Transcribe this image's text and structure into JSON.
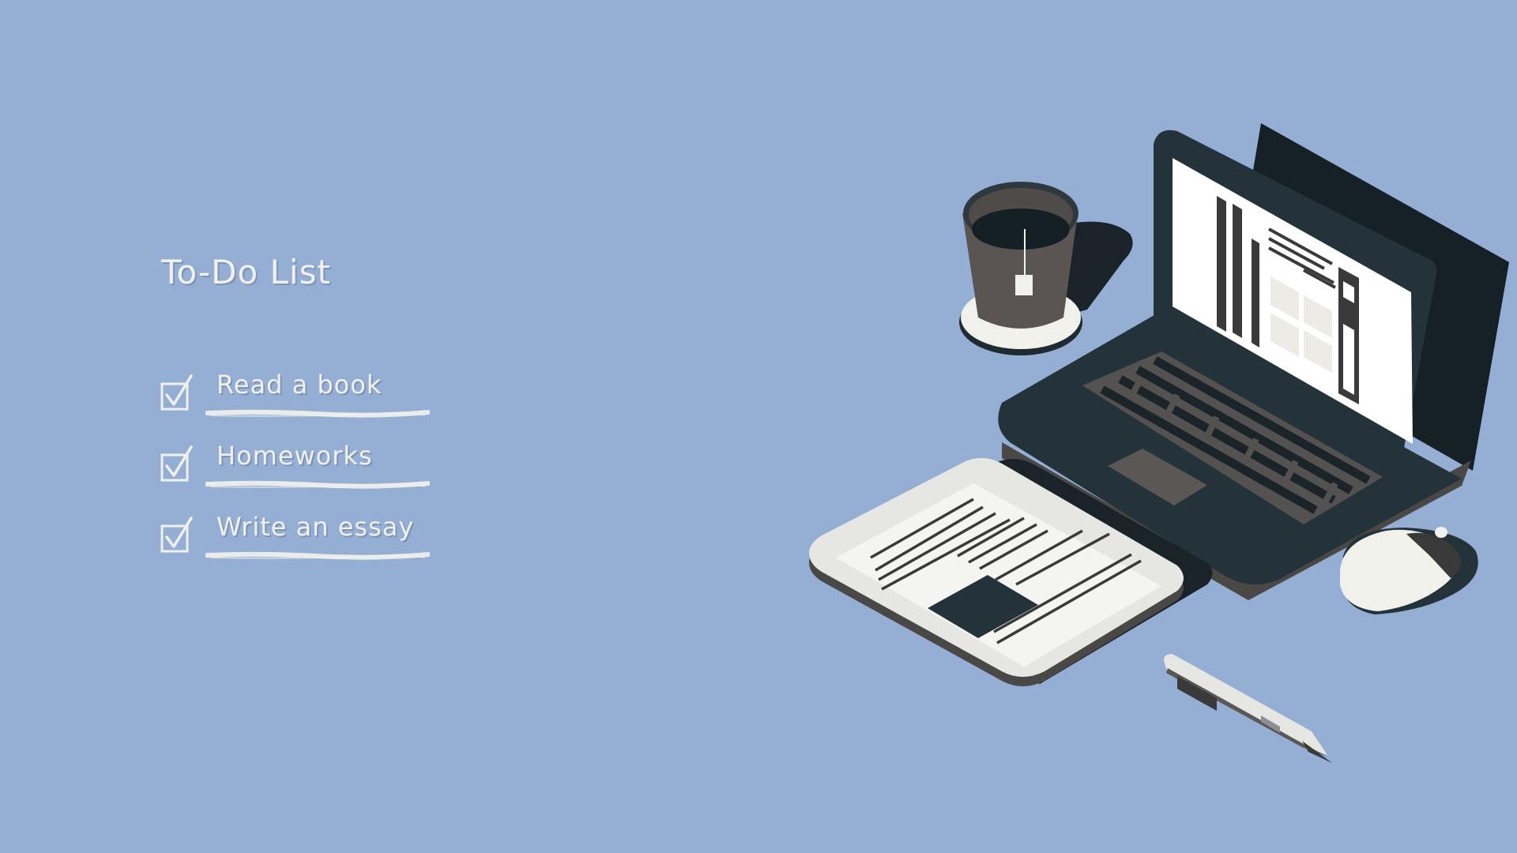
{
  "title": "To-Do List",
  "todos": [
    {
      "label": "Read a book",
      "checked": true
    },
    {
      "label": "Homeworks",
      "checked": true
    },
    {
      "label": "Write an essay",
      "checked": true
    }
  ],
  "colors": {
    "background": "#94aed4",
    "text": "#f1f1ec",
    "laptop_dark": "#1f2b31",
    "laptop_mid": "#263238",
    "screen": "#ffffff",
    "tablet": "#ececea",
    "accent_gray": "#5b5755"
  },
  "icons": [
    "checkbox-icon",
    "laptop-icon",
    "tea-cup-icon",
    "tablet-icon",
    "mouse-icon",
    "pen-icon"
  ]
}
